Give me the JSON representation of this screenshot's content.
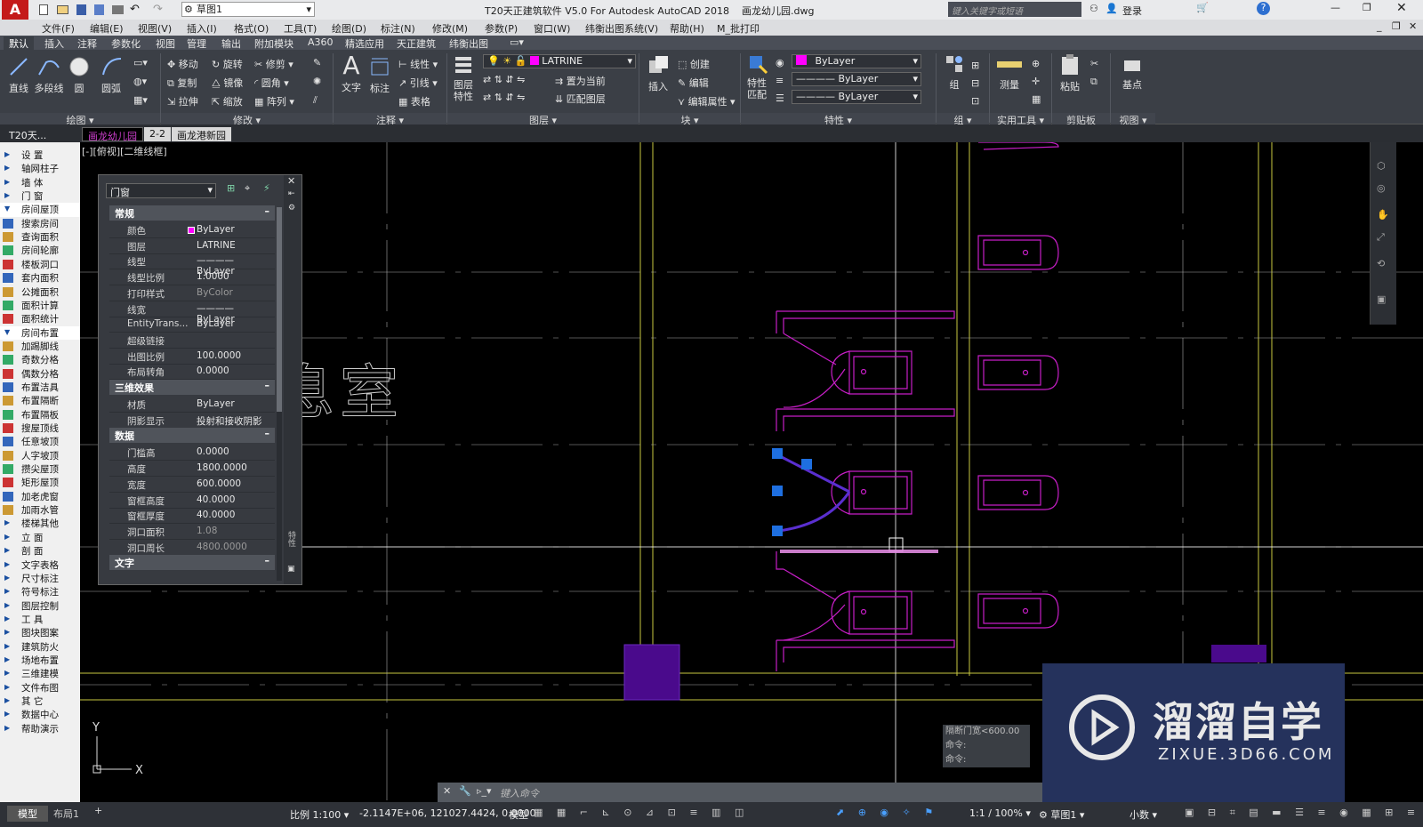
{
  "title": {
    "text": "T20天正建筑软件 V5.0 For Autodesk AutoCAD 2018    画龙幼儿园.dwg",
    "search_placeholder": "键入关键字或短语",
    "login": "登录",
    "workspace": "草图1"
  },
  "menu": [
    "文件(F)",
    "编辑(E)",
    "视图(V)",
    "插入(I)",
    "格式(O)",
    "工具(T)",
    "绘图(D)",
    "标注(N)",
    "修改(M)",
    "参数(P)",
    "窗口(W)",
    "纬衡出图系统(V)",
    "帮助(H)",
    "M_批打印"
  ],
  "ribbon_tabs": [
    "默认",
    "插入",
    "注释",
    "参数化",
    "视图",
    "管理",
    "输出",
    "附加模块",
    "A360",
    "精选应用",
    "天正建筑",
    "纬衡出图"
  ],
  "ribbon": {
    "draw": [
      "直线",
      "多段线",
      "圆",
      "圆弧"
    ],
    "modify": [
      "移动",
      "旋转",
      "修剪",
      "复制",
      "镜像",
      "圆角",
      "拉伸",
      "缩放",
      "阵列"
    ],
    "annot": [
      "文字",
      "标注",
      "线性",
      "引线",
      "表格"
    ],
    "layer": {
      "current": "LATRINE",
      "props": "图层特性",
      "items": [
        "置为当前",
        "匹配图层"
      ]
    },
    "block": [
      "插入",
      "创建",
      "编辑",
      "编辑属性"
    ],
    "props": {
      "match": "特性匹配",
      "color": "ByLayer",
      "linetype": "ByLayer",
      "lineweight": "ByLayer"
    },
    "group": "组",
    "measure": "测量",
    "paste": "粘贴",
    "base": "基点",
    "groups": [
      "绘图",
      "修改",
      "注释",
      "图层",
      "块",
      "特性",
      "组",
      "实用工具",
      "剪贴板",
      "视图"
    ]
  },
  "doc_tabs": [
    "T20天...",
    "画龙幼儿园",
    "2-2",
    "画龙港新园"
  ],
  "viewport_label": "[-][俯视][二维线框]",
  "left_menu": [
    {
      "t": "设    置",
      "arrow": true
    },
    {
      "t": "轴网柱子",
      "arrow": true
    },
    {
      "t": "墙    体",
      "arrow": true
    },
    {
      "t": "门    窗",
      "arrow": true
    },
    {
      "t": "房间屋顶",
      "arrow": true,
      "open": true
    },
    {
      "t": "搜索房间"
    },
    {
      "t": "查询面积"
    },
    {
      "t": "房间轮廓"
    },
    {
      "t": "楼板洞口"
    },
    {
      "t": "套内面积"
    },
    {
      "t": "公摊面积"
    },
    {
      "t": "面积计算"
    },
    {
      "t": "面积统计"
    },
    {
      "t": "房间布置",
      "arrow": true,
      "open": true
    },
    {
      "t": "加踢脚线"
    },
    {
      "t": "奇数分格"
    },
    {
      "t": "偶数分格"
    },
    {
      "t": "布置洁具"
    },
    {
      "t": "布置隔断"
    },
    {
      "t": "布置隔板"
    },
    {
      "t": "搜屋顶线"
    },
    {
      "t": "任意坡顶"
    },
    {
      "t": "人字坡顶"
    },
    {
      "t": "攒尖屋顶"
    },
    {
      "t": "矩形屋顶"
    },
    {
      "t": "加老虎窗"
    },
    {
      "t": "加雨水管"
    },
    {
      "t": "楼梯其他",
      "arrow": true
    },
    {
      "t": "立    面",
      "arrow": true
    },
    {
      "t": "剖    面",
      "arrow": true
    },
    {
      "t": "文字表格",
      "arrow": true
    },
    {
      "t": "尺寸标注",
      "arrow": true
    },
    {
      "t": "符号标注",
      "arrow": true
    },
    {
      "t": "图层控制",
      "arrow": true
    },
    {
      "t": "工    具",
      "arrow": true
    },
    {
      "t": "图块图案",
      "arrow": true
    },
    {
      "t": "建筑防火",
      "arrow": true
    },
    {
      "t": "场地布置",
      "arrow": true
    },
    {
      "t": "三维建模",
      "arrow": true
    },
    {
      "t": "文件布图",
      "arrow": true
    },
    {
      "t": "其    它",
      "arrow": true
    },
    {
      "t": "数据中心",
      "arrow": true
    },
    {
      "t": "帮助演示",
      "arrow": true
    }
  ],
  "props_panel": {
    "object": "门窗",
    "side_label": "特性",
    "sections": [
      {
        "name": "常规",
        "rows": [
          [
            "颜色",
            "ByLayer"
          ],
          [
            "图层",
            "LATRINE"
          ],
          [
            "线型",
            "———— ByLayer"
          ],
          [
            "线型比例",
            "1.0000"
          ],
          [
            "打印样式",
            "ByColor"
          ],
          [
            "线宽",
            "———— ByLayer"
          ],
          [
            "EntityTrans...",
            "ByLayer"
          ],
          [
            "超级链接",
            ""
          ],
          [
            "出图比例",
            "100.0000"
          ],
          [
            "布局转角",
            "0.0000"
          ]
        ]
      },
      {
        "name": "三维效果",
        "rows": [
          [
            "材质",
            "ByLayer"
          ],
          [
            "阴影显示",
            "投射和接收阴影"
          ]
        ]
      },
      {
        "name": "数据",
        "rows": [
          [
            "门槛高",
            "0.0000"
          ],
          [
            "高度",
            "1800.0000"
          ],
          [
            "宽度",
            "600.0000"
          ],
          [
            "窗框高度",
            "40.0000"
          ],
          [
            "窗框厚度",
            "40.0000"
          ],
          [
            "洞口面积",
            "1.08"
          ],
          [
            "洞口周长",
            "4800.0000"
          ]
        ]
      },
      {
        "name": "文字",
        "rows": []
      }
    ]
  },
  "canvas_text": [
    "息室"
  ],
  "command_history": [
    "隔断门宽<600.00",
    "命令:",
    "命令:"
  ],
  "command_placeholder": "键入命令",
  "watermark": {
    "name": "溜溜自学",
    "url": "ZIXUE.3D66.COM"
  },
  "status": {
    "model_tabs": [
      "模型",
      "布局1"
    ],
    "scale": "比例 1:100",
    "coords": "-2.1147E+06, 121027.4424, 0.0000",
    "model": "模型",
    "anno_scale": "1:1 / 100%",
    "workspace": "草图1",
    "units": "小数"
  },
  "colors": {
    "magenta": "#c61ec6",
    "yellow": "#c8c840",
    "blue_grip": "#1e6fe0",
    "purple_fill": "#4a0a8c",
    "ucs": "#dddddd"
  }
}
